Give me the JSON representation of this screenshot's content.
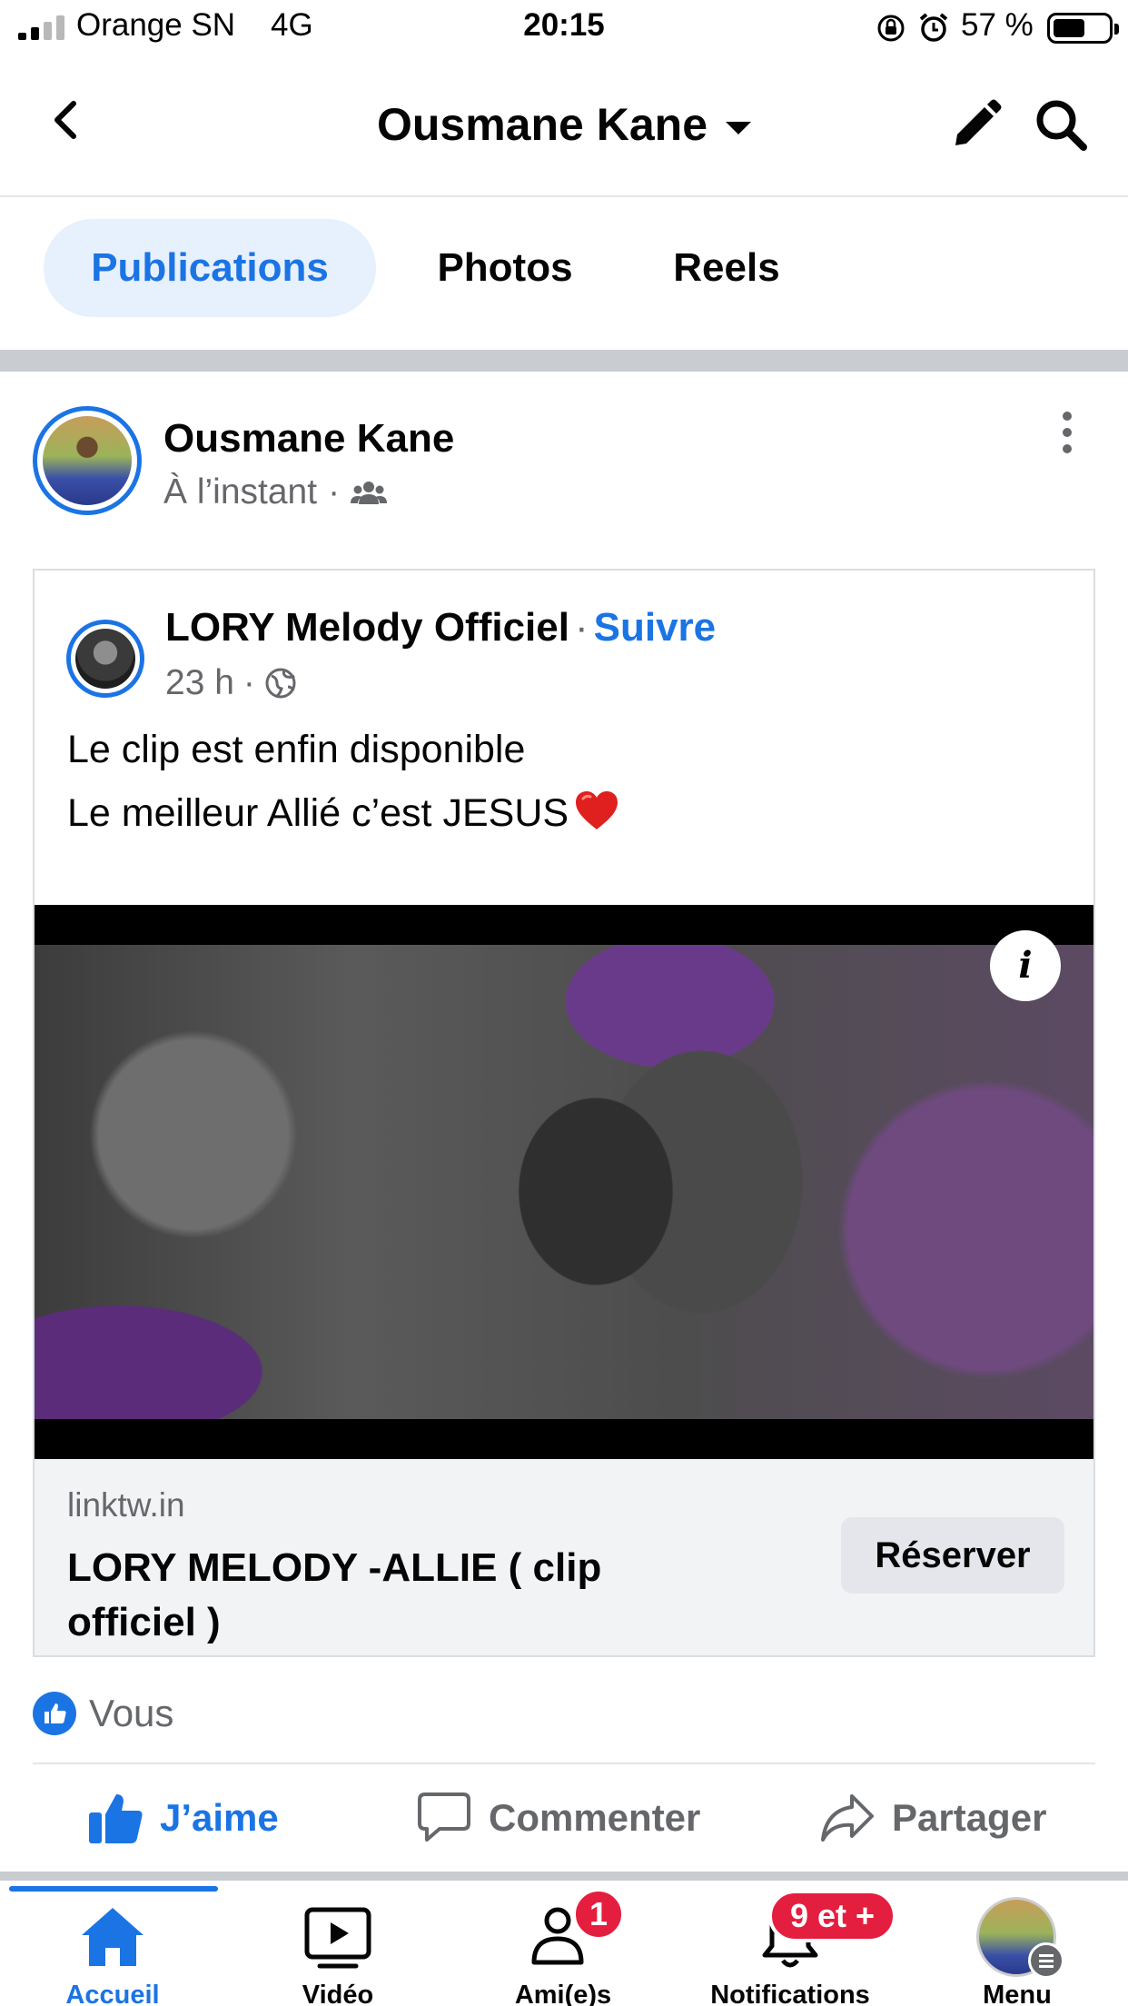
{
  "status_bar": {
    "carrier": "Orange SN",
    "network": "4G",
    "time": "20:15",
    "battery": "57 %"
  },
  "nav": {
    "title": "Ousmane Kane"
  },
  "tabs": [
    {
      "label": "Publications",
      "active": true
    },
    {
      "label": "Photos",
      "active": false
    },
    {
      "label": "Reels",
      "active": false
    }
  ],
  "post": {
    "author": "Ousmane Kane",
    "time": "À l’instant",
    "audience_icon": "friends-icon",
    "shared": {
      "page_name": "LORY Melody Officiel",
      "follow_label": "Suivre",
      "time": "23 h",
      "privacy_icon": "globe-icon",
      "text_line1": "Le clip est enfin disponible",
      "text_line2": "Le meilleur Allié c’est JESUS",
      "link": {
        "domain": "linktw.in",
        "title": "LORY MELODY -ALLIE ( clip officiel )",
        "button": "Réserver"
      }
    },
    "reactions_label": "Vous",
    "actions": {
      "like": "J’aime",
      "comment": "Commenter",
      "share": "Partager"
    }
  },
  "bottom_nav": {
    "home": "Accueil",
    "video": "Vidéo",
    "friends": "Ami(e)s",
    "friends_badge": "1",
    "notifications": "Notifications",
    "notifications_badge": "9 et +",
    "menu": "Menu"
  },
  "colors": {
    "accent": "#1b74e4",
    "badge": "#e41e3f",
    "secondary_text": "#65676b"
  }
}
